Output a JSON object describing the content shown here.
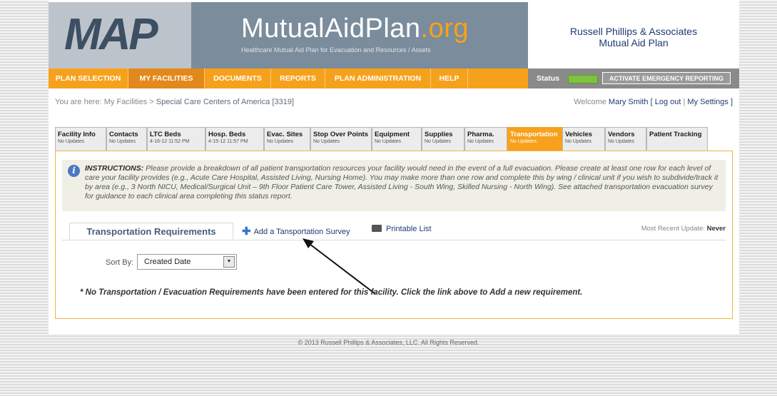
{
  "header": {
    "logo": "MAP",
    "brand_name": "MutualAidPlan",
    "brand_suffix": ".org",
    "tagline": "Healthcare Mutual Aid Plan for Evacuation and Resources / Assets",
    "client_line1": "Russell Phillips & Associates",
    "client_line2": "Mutual Aid Plan"
  },
  "nav": {
    "items": [
      {
        "label": "Plan Selection"
      },
      {
        "label": "My Facilities"
      },
      {
        "label": "Documents"
      },
      {
        "label": "Reports"
      },
      {
        "label": "Plan Administration"
      },
      {
        "label": "Help"
      }
    ],
    "status_label": "Status",
    "activate_label": "Activate Emergency Reporting"
  },
  "breadcrumb": {
    "prefix": "You are here:",
    "link": "My Facilities",
    "separator": ">",
    "current": "Special Care Centers of America [3319]"
  },
  "welcome": {
    "label": "Welcome",
    "name": "Mary Smith",
    "logout": "[ Log out",
    "divider": "|",
    "settings": "My Settings ]"
  },
  "tabs": [
    {
      "name": "Facility Info",
      "sub": "No Updates"
    },
    {
      "name": "Contacts",
      "sub": "No Updates"
    },
    {
      "name": "LTC Beds",
      "sub": "4-16-12 11:52 PM"
    },
    {
      "name": "Hosp. Beds",
      "sub": "4-15-12 11:57 PM"
    },
    {
      "name": "Evac. Sites",
      "sub": "No Updates"
    },
    {
      "name": "Stop Over Points",
      "sub": "No Updates"
    },
    {
      "name": "Equipment",
      "sub": "No Updates"
    },
    {
      "name": "Supplies",
      "sub": "No Updates"
    },
    {
      "name": "Pharma.",
      "sub": "No Updates"
    },
    {
      "name": "Transportation",
      "sub": "No Updates"
    },
    {
      "name": "Vehicles",
      "sub": "No Updates"
    },
    {
      "name": "Vendors",
      "sub": "No Updates"
    },
    {
      "name": "Patient Tracking",
      "sub": ""
    }
  ],
  "instructions": {
    "heading": "INSTRUCTIONS:",
    "body": "Please provide a breakdown of all patient transportation resources your facility would need in the event of a full evacuation. Please create at least one row for each level of care your facility provides (e.g., Acute Care Hospital, Assisted Living, Nursing Home). You may make more than one row and complete this by wing / clinical unit if you wish to subdivide/track it by area (e.g., 3 North NICU, Medical/Surgical Unit – 9th Floor Patient Care Tower, Assisted Living - South Wing, Skilled Nursing - North Wing). See attached transportation evacuation survey for guidance to each clinical area completing this status report."
  },
  "section": {
    "tab_label": "Transportation Requirements",
    "add_link": "Add a Tansportation Survey",
    "print_link": "Printable List",
    "recent_label": "Most Recent Update:",
    "recent_value": "Never",
    "sort_label": "Sort By:",
    "sort_value": "Created Date",
    "empty_message": "* No Transportation / Evacuation Requirements have been entered for this facility. Click the link above to Add a new requirement."
  },
  "footer": "© 2013 Russell Phillips & Associates, LLC. All Rights Reserved.",
  "colors": {
    "accent_orange": "#f6a11c",
    "brand_blue": "#1f3a73",
    "status_green": "#7dc33f"
  }
}
